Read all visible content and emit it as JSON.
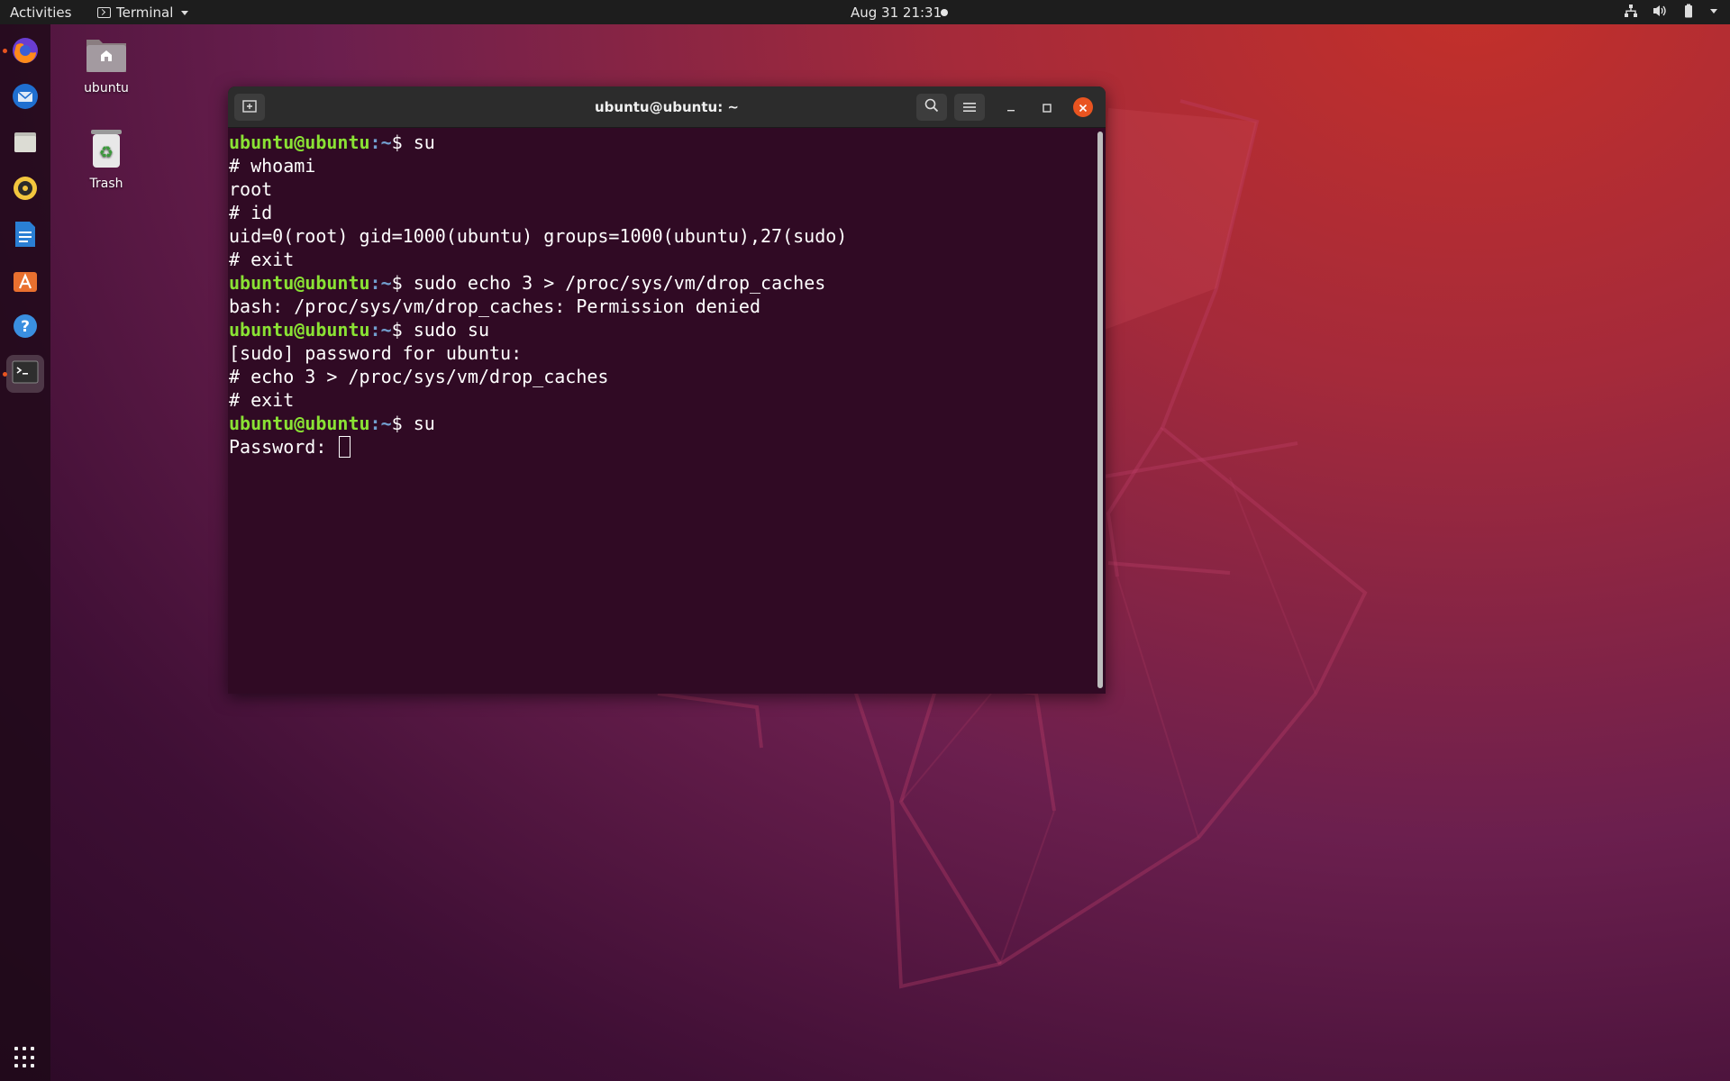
{
  "topbar": {
    "activities": "Activities",
    "app_name": "Terminal",
    "clock": "Aug 31  21:31"
  },
  "dock": {
    "items": [
      {
        "name": "firefox",
        "running": true
      },
      {
        "name": "thunderbird",
        "running": false
      },
      {
        "name": "files",
        "running": false
      },
      {
        "name": "rhythmbox",
        "running": false
      },
      {
        "name": "libreoffice-writer",
        "running": false
      },
      {
        "name": "ubuntu-software",
        "running": false
      },
      {
        "name": "help",
        "running": false
      },
      {
        "name": "terminal",
        "running": true
      }
    ]
  },
  "desktop": {
    "home_label": "ubuntu",
    "trash_label": "Trash"
  },
  "terminal": {
    "title": "ubuntu@ubuntu: ~",
    "prompt_user": "ubuntu@ubuntu",
    "prompt_path": ":~",
    "lines": [
      {
        "type": "prompt",
        "cmd": "$ su"
      },
      {
        "type": "out",
        "text": "# whoami"
      },
      {
        "type": "out",
        "text": "root"
      },
      {
        "type": "out",
        "text": "# id"
      },
      {
        "type": "out",
        "text": "uid=0(root) gid=1000(ubuntu) groups=1000(ubuntu),27(sudo)"
      },
      {
        "type": "out",
        "text": "# exit"
      },
      {
        "type": "prompt",
        "cmd": "$ sudo echo 3 > /proc/sys/vm/drop_caches"
      },
      {
        "type": "out",
        "text": "bash: /proc/sys/vm/drop_caches: Permission denied"
      },
      {
        "type": "prompt",
        "cmd": "$ sudo su"
      },
      {
        "type": "out",
        "text": "[sudo] password for ubuntu:"
      },
      {
        "type": "out",
        "text": "# echo 3 > /proc/sys/vm/drop_caches"
      },
      {
        "type": "out",
        "text": "# exit"
      },
      {
        "type": "prompt",
        "cmd": "$ su"
      },
      {
        "type": "input",
        "text": "Password: "
      }
    ]
  },
  "colors": {
    "accent": "#e95420",
    "terminal_bg": "#300a24",
    "prompt_user": "#8ae234",
    "prompt_path": "#729fcf"
  }
}
